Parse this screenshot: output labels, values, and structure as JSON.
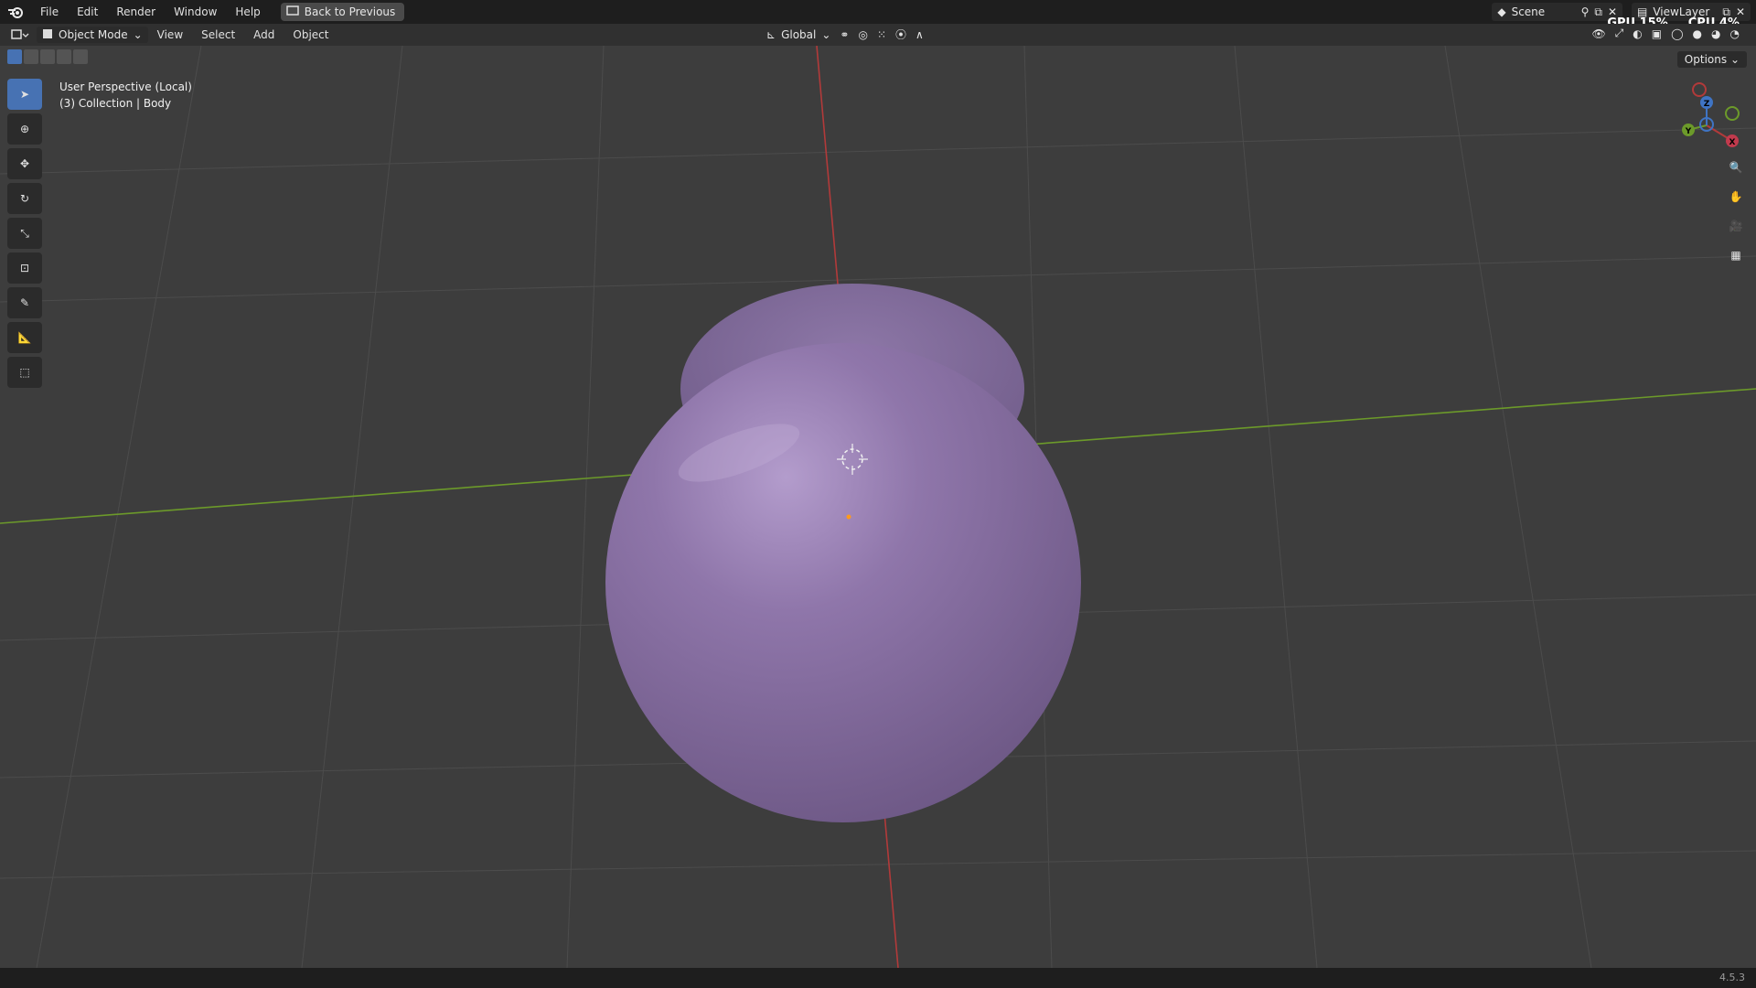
{
  "menubar": {
    "items": [
      "File",
      "Edit",
      "Render",
      "Window",
      "Help"
    ],
    "back_button": "Back to Previous"
  },
  "topright": {
    "scene": "Scene",
    "viewlayer": "ViewLayer",
    "gpu": "GPU 15%",
    "cpu": "CPU 4%"
  },
  "header": {
    "mode": "Object Mode",
    "menus": [
      "View",
      "Select",
      "Add",
      "Object"
    ],
    "transform_orientation": "Global"
  },
  "viewport": {
    "perspective": "User Perspective (Local)",
    "collection": "(3) Collection | Body",
    "options": "Options"
  },
  "gizmo": {
    "axis_x": "X",
    "axis_y": "Y",
    "axis_z": "Z"
  },
  "status": {
    "version": "4.5.3"
  },
  "colors": {
    "accent": "#4772b3",
    "object": "#8a71a6",
    "x_axis": "#b23a3a",
    "y_axis": "#6c9a2a"
  }
}
